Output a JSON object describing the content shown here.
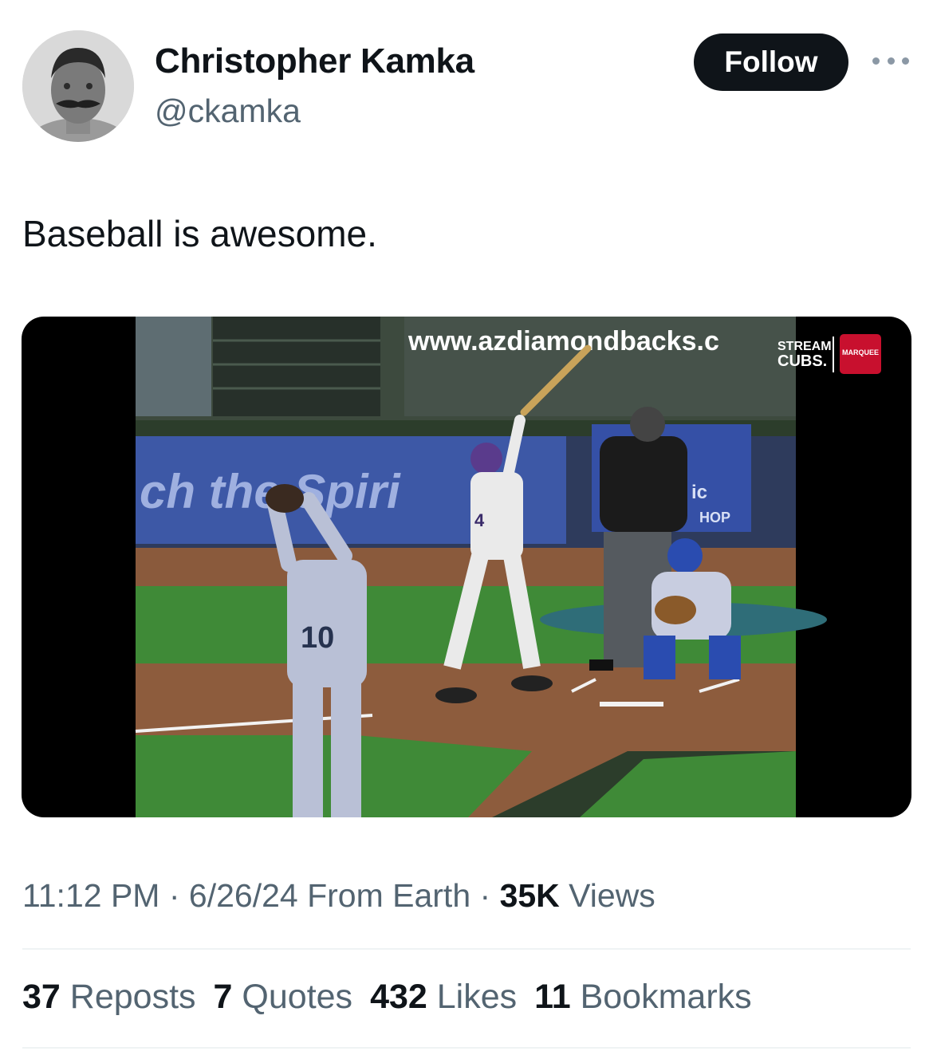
{
  "author": {
    "display_name": "Christopher Kamka",
    "handle": "@ckamka"
  },
  "follow_label": "Follow",
  "tweet": {
    "text": "Baseball is awesome."
  },
  "video": {
    "banner_text": "www.azdiamondbacks.c",
    "wall_text": "ch the Spiri",
    "watermark_stream": "STREAM",
    "watermark_cubs": "CUBS.",
    "watermark_marquee": "MARQUEE",
    "sign_shop": "HOP",
    "sign_ic": "ic",
    "pitcher_number": "10",
    "batter_number": "4"
  },
  "meta": {
    "time": "11:12 PM",
    "sep1": " · ",
    "date": "6/26/24",
    "source": " From Earth",
    "sep2": " · ",
    "views_count": "35K",
    "views_label": " Views"
  },
  "stats": [
    {
      "count": "37",
      "label": " Reposts"
    },
    {
      "count": "7",
      "label": " Quotes"
    },
    {
      "count": "432",
      "label": " Likes"
    },
    {
      "count": "11",
      "label": " Bookmarks"
    }
  ],
  "colors": {
    "text_primary": "#0f1419",
    "text_secondary": "#536471",
    "button_bg": "#0f1419"
  }
}
